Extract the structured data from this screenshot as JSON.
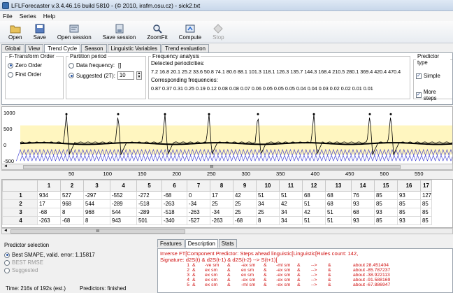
{
  "window": {
    "title": "LFLForecaster v.3.4.46.16 build 5810 - (© 2010, irafm.osu.cz) - sick2.txt"
  },
  "menu": [
    "File",
    "Series",
    "Help"
  ],
  "toolbar": [
    {
      "label": "Open",
      "icon": "folder-icon",
      "enabled": true
    },
    {
      "label": "Save",
      "icon": "save-icon",
      "enabled": true
    },
    {
      "label": "Open session",
      "icon": "open-session-icon",
      "enabled": true
    },
    {
      "label": "Save session",
      "icon": "save-session-icon",
      "enabled": true
    },
    {
      "label": "ZoomFit",
      "icon": "zoom-icon",
      "enabled": true
    },
    {
      "label": "Compute",
      "icon": "compute-icon",
      "enabled": true
    },
    {
      "label": "Stop",
      "icon": "stop-icon",
      "enabled": false
    }
  ],
  "tabs": [
    "Global",
    "View",
    "Trend Cycle",
    "Season",
    "Linguistic Variables",
    "Trend evaluation"
  ],
  "active_tab": "Trend Cycle",
  "ftransform": {
    "legend": "F-Transform Order",
    "options": [
      "Zero Order",
      "First Order"
    ],
    "selected": "Zero Order"
  },
  "partition": {
    "legend": "Partition period",
    "data_freq": "Data frequency:",
    "data_freq_value": "[]",
    "suggested": "Suggested (2T):",
    "suggested_value": "10"
  },
  "freq": {
    "legend": "Frequency analysis",
    "detected_label": "Detected periodicities:",
    "detected": "7.2 16.8 20.1 25.2 33.6 50.8 74.1 80.6 88.1 101.3 118.1 126.3 135.7 144.3 168.4 210.5 280.1 369.4 420.4 470.4",
    "corr_label": "Corresponding frequencies:",
    "corr": "0.87 0.37 0.31 0.25 0.19 0.12 0.08 0.08 0.07 0.06 0.05 0.05 0.05 0.04 0.04 0.03 0.02 0.02 0.01 0.01"
  },
  "predictor": {
    "legend": "Predictor type",
    "simple": "Simple",
    "more": "More steps"
  },
  "chart": {
    "y_ticks": [
      "1000",
      "500",
      "0",
      "-500"
    ],
    "x_ticks": [
      "50",
      "100",
      "150",
      "200",
      "250",
      "300",
      "350",
      "400",
      "450",
      "500",
      "550"
    ],
    "series_color": "#000000",
    "fuzzy_color": "#3a3ad0",
    "band_color": "#fff6c0"
  },
  "scroll_marker": "III",
  "grid": {
    "columns": [
      "1",
      "2",
      "3",
      "4",
      "5",
      "6",
      "7",
      "8",
      "9",
      "10",
      "11",
      "12",
      "13",
      "14",
      "15",
      "16",
      "17"
    ],
    "rows": [
      {
        "h": "1",
        "cells": [
          "934",
          "527",
          "-297",
          "-552",
          "-272",
          "-68",
          "0",
          "17",
          "42",
          "51",
          "51",
          "68",
          "68",
          "76",
          "85",
          "93",
          "127"
        ]
      },
      {
        "h": "2",
        "cells": [
          "17",
          "968",
          "544",
          "-289",
          "-518",
          "-263",
          "-34",
          "25",
          "25",
          "34",
          "42",
          "51",
          "68",
          "93",
          "85",
          "85",
          "85"
        ]
      },
      {
        "h": "3",
        "cells": [
          "-68",
          "8",
          "968",
          "544",
          "-289",
          "-518",
          "-263",
          "-34",
          "25",
          "25",
          "34",
          "42",
          "51",
          "68",
          "93",
          "85",
          "85"
        ]
      },
      {
        "h": "4",
        "cells": [
          "-263",
          "-68",
          "8",
          "943",
          "501",
          "-340",
          "-527",
          "-263",
          "-68",
          "8",
          "34",
          "51",
          "51",
          "93",
          "85",
          "93",
          "85"
        ]
      }
    ]
  },
  "predsel": {
    "legend": "Predictor selection",
    "best_smape": "Best SMAPE, valid. error: 1.15817",
    "best_rmse": "BEST RMSE",
    "suggested": "Suggested",
    "time": "Time:  216s of 192s (est.)",
    "predictors": "Predictors:   finished"
  },
  "bottom_tabs": [
    "Features",
    "Description",
    "Stats"
  ],
  "description": {
    "line1": "Inverse FT[Component Predictor: Steps ahead linguistic[Linguistic[Rules count: 142,",
    "line2": "Signature: d2S(t) & d2S(t-1) & d2S(t-2) --> S(t+1)[",
    "rules": [
      [
        "1",
        "&",
        "-ve sm",
        "&",
        "-ex sm",
        "&",
        "-ml sm",
        "&",
        "-->",
        "&",
        "about 28.451404"
      ],
      [
        "2",
        "&",
        "ex sm",
        "&",
        "ex sm",
        "&",
        "-ex sm",
        "&",
        "-->",
        "&",
        "about -85.787237"
      ],
      [
        "3",
        "&",
        "ex sm",
        "&",
        "ex sm",
        "&",
        "-ex sm",
        "&",
        "-->",
        "&",
        "about -38.922113"
      ],
      [
        "4",
        "&",
        "ex sm",
        "&",
        "-ex sm",
        "&",
        "-ex sm",
        "&",
        "-->",
        "&",
        "about -91.588169"
      ],
      [
        "5",
        "&",
        "ex sm",
        "&",
        "-ml sm",
        "&",
        "-ex sm",
        "&",
        "-->",
        "&",
        "about -67.886947"
      ]
    ]
  }
}
